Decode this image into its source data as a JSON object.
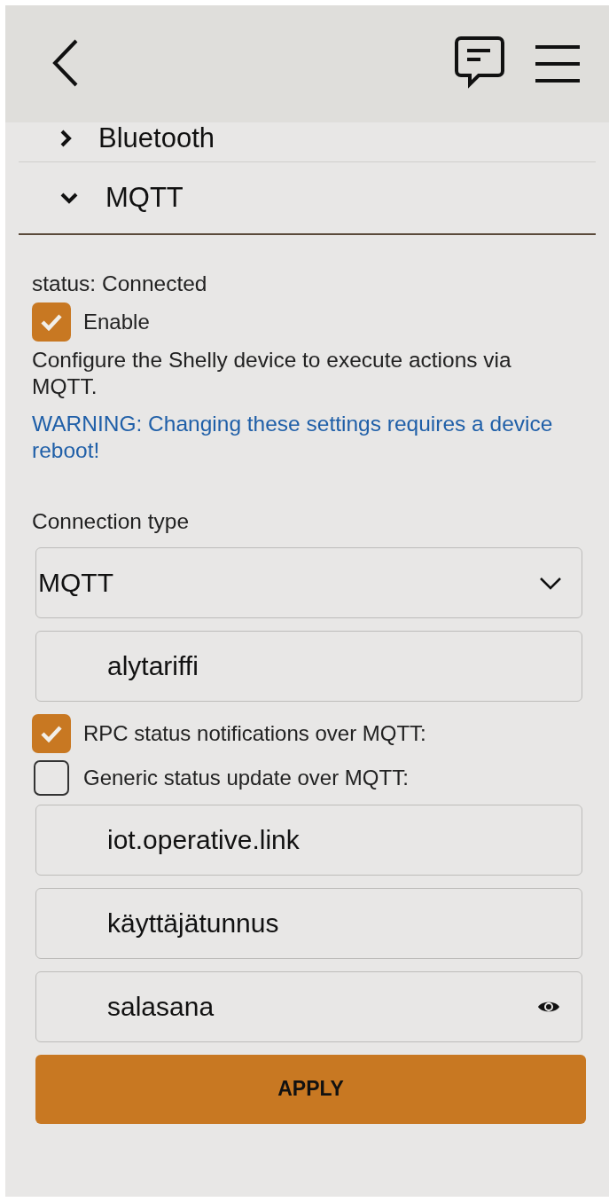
{
  "sections": [
    {
      "title": "Bluetooth",
      "expanded": false
    },
    {
      "title": "MQTT",
      "expanded": true
    }
  ],
  "status": "status: Connected",
  "enable": {
    "label": "Enable",
    "checked": true
  },
  "description": "Configure the Shelly device to execute actions via MQTT.",
  "warning": "WARNING: Changing these settings requires a device reboot!",
  "connection_type": {
    "label": "Connection type",
    "value": "MQTT"
  },
  "fields_top": [
    {
      "kind": "text",
      "value": "alytariffi"
    }
  ],
  "options": [
    {
      "label": "RPC status notifications over MQTT:",
      "checked": true
    },
    {
      "label": "Generic status update over MQTT:",
      "checked": false
    }
  ],
  "fields": [
    {
      "kind": "text",
      "value": "iot.operative.link"
    },
    {
      "kind": "text",
      "value": "käyttäjätunnus"
    },
    {
      "kind": "password",
      "value": "salasana"
    }
  ],
  "apply": "APPLY"
}
